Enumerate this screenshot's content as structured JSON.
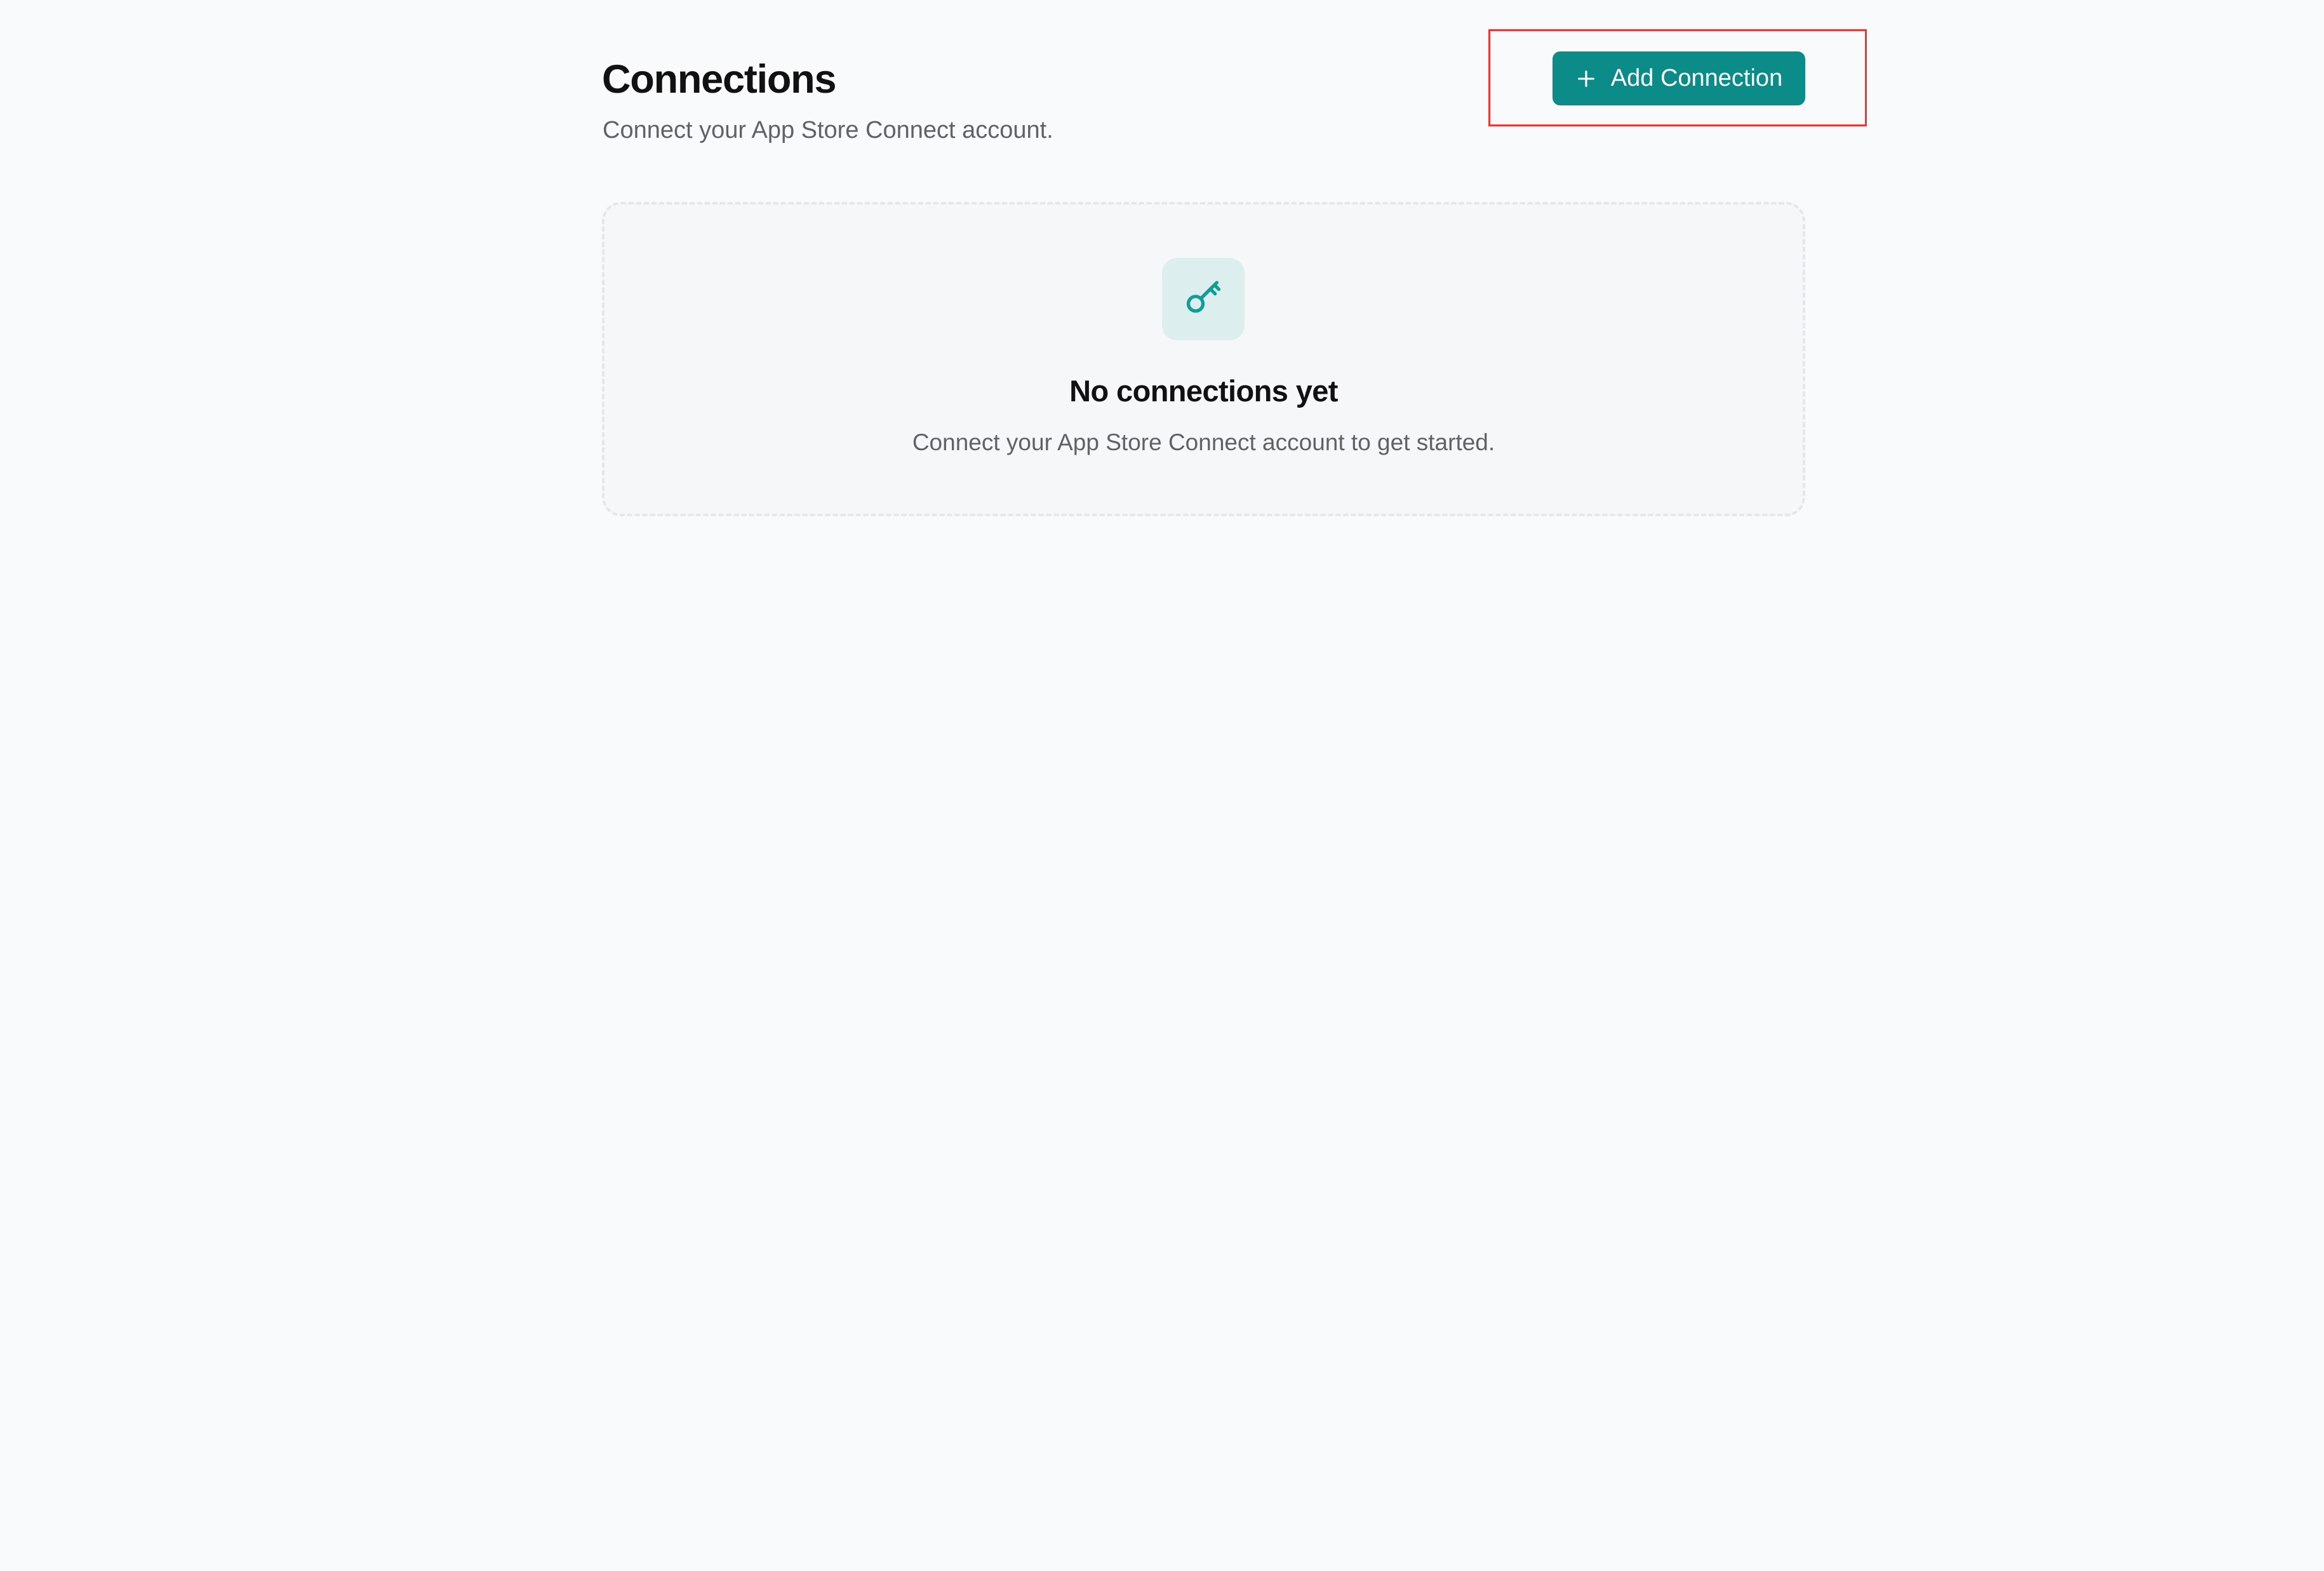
{
  "header": {
    "title": "Connections",
    "subtitle": "Connect your App Store Connect account."
  },
  "actions": {
    "add_connection_label": "Add Connection",
    "add_icon": "plus-icon"
  },
  "empty_state": {
    "icon": "key-icon",
    "title": "No connections yet",
    "description": "Connect your App Store Connect account to get started."
  },
  "colors": {
    "accent": "#0b8c88",
    "icon_tile": "#dcefee",
    "highlight": "#e53935",
    "background": "#f9fafb"
  }
}
